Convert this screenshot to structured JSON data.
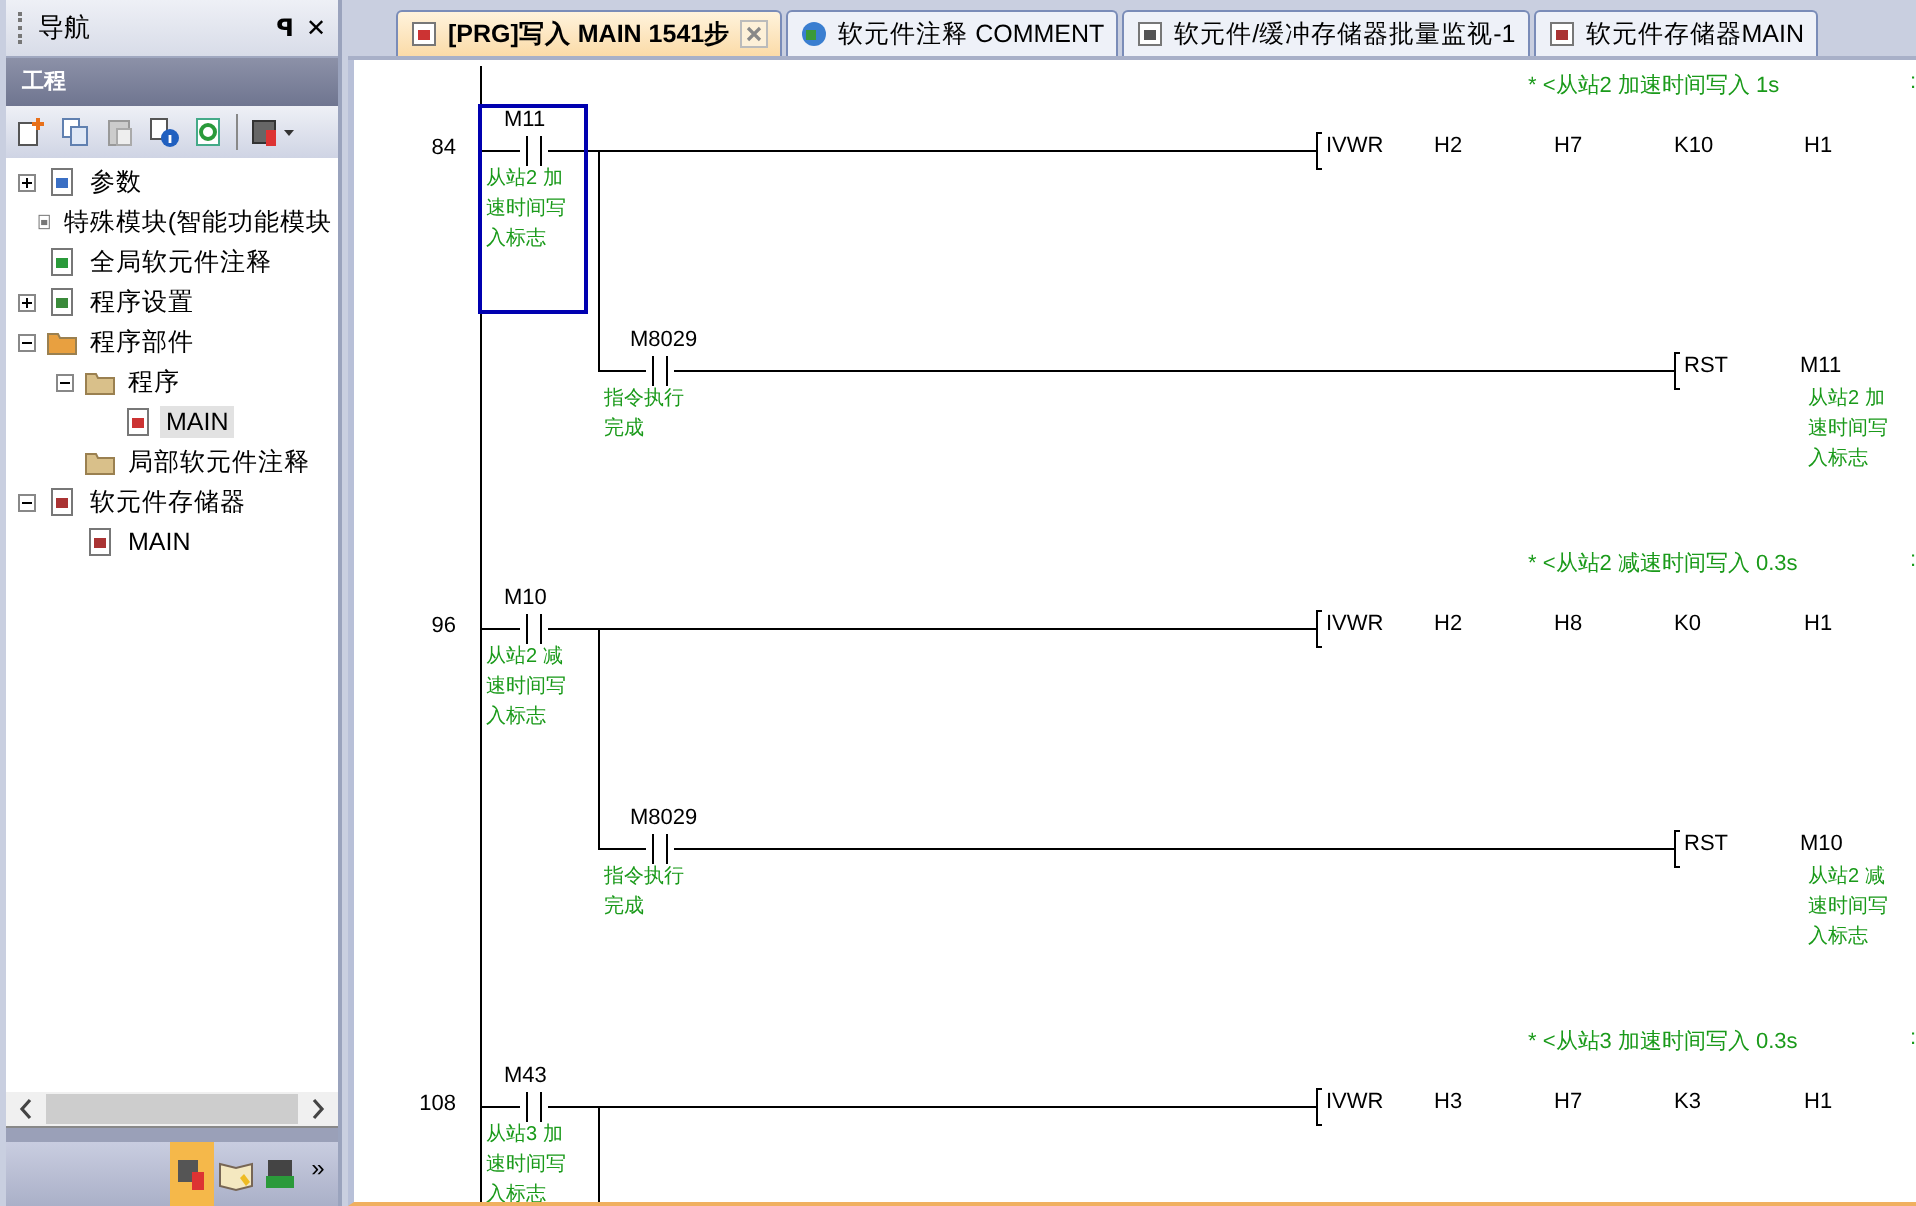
{
  "navigator": {
    "title": "导航",
    "pin": "ꟼ",
    "close": "✕",
    "section": "工程",
    "tree": [
      {
        "label": "参数",
        "kind": "parameter",
        "expanded": false,
        "selected": false
      },
      {
        "label": "特殊模块(智能功能模块",
        "kind": "module",
        "selected": false
      },
      {
        "label": "全局软元件注释",
        "kind": "comment",
        "selected": false
      },
      {
        "label": "程序设置",
        "kind": "setting",
        "expanded": false,
        "selected": false
      },
      {
        "label": "程序部件",
        "kind": "parts",
        "expanded": true,
        "selected": false,
        "children": [
          {
            "label": "程序",
            "kind": "folder",
            "expanded": true,
            "selected": false,
            "children": [
              {
                "label": "MAIN",
                "kind": "program",
                "selected": true
              }
            ]
          },
          {
            "label": "局部软元件注释",
            "kind": "folder",
            "selected": false
          }
        ]
      },
      {
        "label": "软元件存储器",
        "kind": "memory",
        "expanded": true,
        "selected": false,
        "children": [
          {
            "label": "MAIN",
            "kind": "memory-item",
            "selected": false
          }
        ]
      }
    ],
    "more": "»",
    "nav_buttons": [
      {
        "selected": true
      },
      {
        "selected": false
      },
      {
        "selected": false
      }
    ]
  },
  "tabs": [
    {
      "label": "[PRG]写入 MAIN 1541步",
      "kind": "program",
      "selected": true,
      "closable": true
    },
    {
      "label": "软元件注释 COMMENT",
      "kind": "comment",
      "selected": false,
      "closable": false
    },
    {
      "label": "软元件/缓冲存储器批量监视-1",
      "kind": "monitor",
      "selected": false,
      "closable": false
    },
    {
      "label": "软元件存储器MAIN",
      "kind": "memory",
      "selected": false,
      "closable": false
    }
  ],
  "rungs": [
    {
      "step": "84",
      "statement": "* <从站2 加速时间写入 1s",
      "statement_end": ":",
      "contact": {
        "device": "M11",
        "comment": [
          "从站2 加",
          "速时间写",
          "入标志"
        ],
        "selected": true
      },
      "instruction": {
        "op": "IVWR",
        "operands": [
          "H2",
          "H7",
          "K10",
          "H1"
        ]
      },
      "branch": {
        "contact": {
          "device": "M8029",
          "comment": [
            "指令执行",
            "完成"
          ]
        },
        "op": "RST",
        "operand": "M11",
        "operand_comment": [
          "从站2 加",
          "速时间写",
          "入标志"
        ]
      }
    },
    {
      "step": "96",
      "statement": "* <从站2 减速时间写入 0.3s",
      "statement_end": ":",
      "contact": {
        "device": "M10",
        "comment": [
          "从站2 减",
          "速时间写",
          "入标志"
        ],
        "selected": false
      },
      "instruction": {
        "op": "IVWR",
        "operands": [
          "H2",
          "H8",
          "K0",
          "H1"
        ]
      },
      "branch": {
        "contact": {
          "device": "M8029",
          "comment": [
            "指令执行",
            "完成"
          ]
        },
        "op": "RST",
        "operand": "M10",
        "operand_comment": [
          "从站2 减",
          "速时间写",
          "入标志"
        ]
      }
    },
    {
      "step": "108",
      "statement": "* <从站3 加速时间写入 0.3s",
      "statement_end": ":",
      "contact": {
        "device": "M43",
        "comment": [
          "从站3 加",
          "速时间写",
          "入标志"
        ],
        "selected": false
      },
      "instruction": {
        "op": "IVWR",
        "operands": [
          "H3",
          "H7",
          "K3",
          "H1"
        ]
      }
    }
  ]
}
